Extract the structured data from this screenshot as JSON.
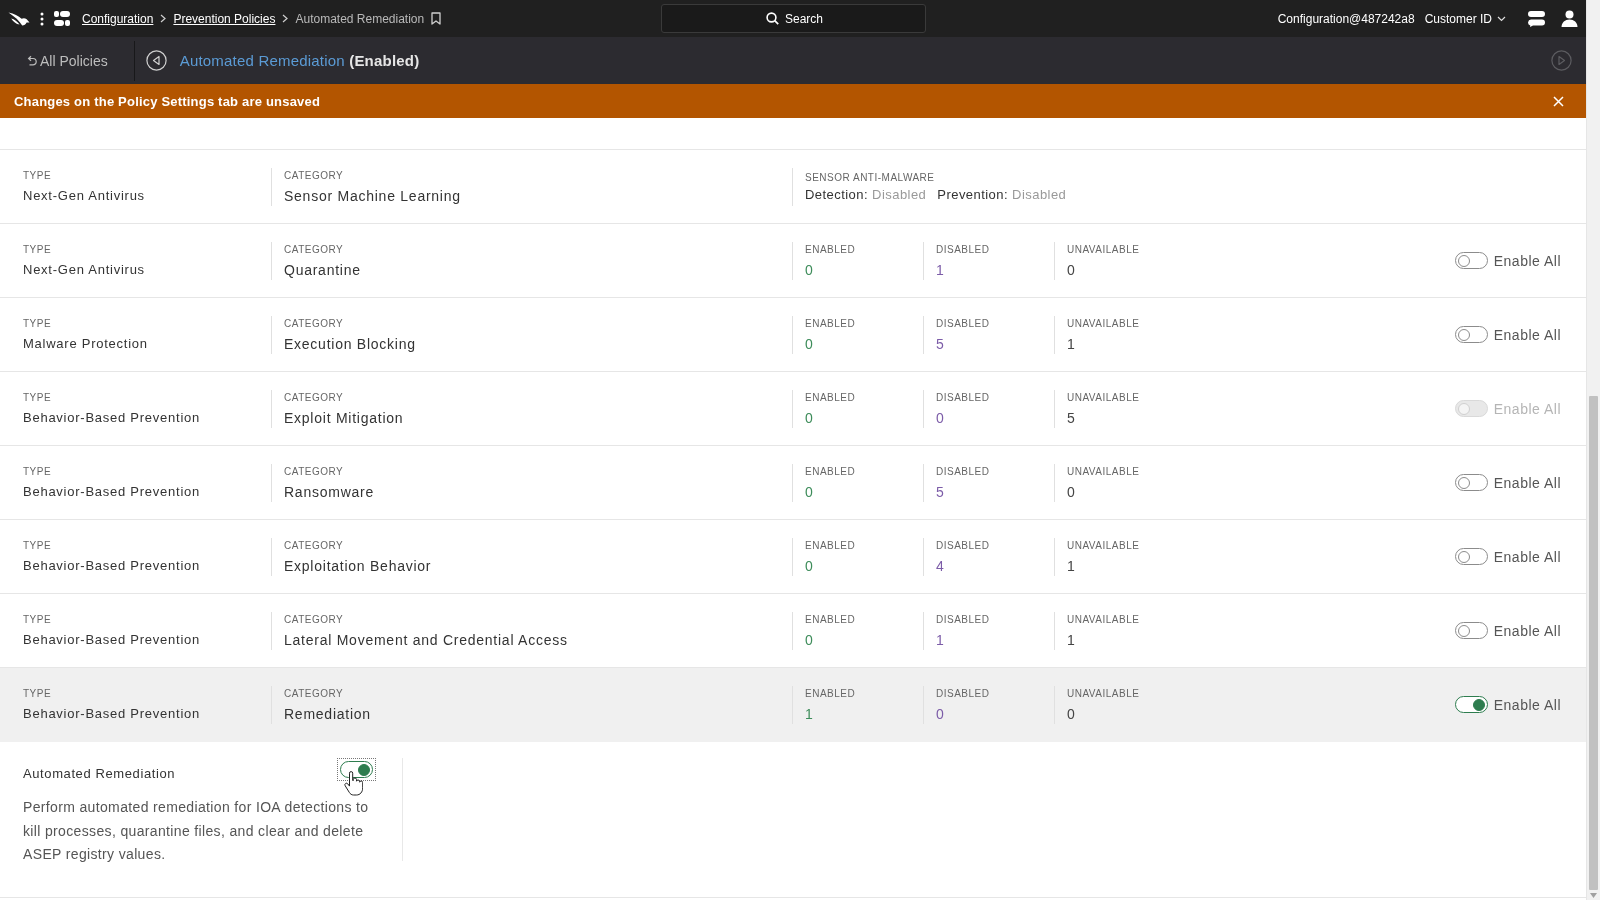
{
  "topbar": {
    "breadcrumbs": [
      {
        "label": "Configuration",
        "link": true
      },
      {
        "label": "Prevention Policies",
        "link": true
      },
      {
        "label": "Automated Remediation",
        "link": false
      }
    ],
    "search": {
      "placeholder": "Search"
    },
    "account": "Configuration@487242a8",
    "customer_menu": "Customer ID"
  },
  "policy_bar": {
    "back_label": "All Policies",
    "policy_name": "Automated Remediation",
    "policy_status": "(Enabled)"
  },
  "banner": {
    "message": "Changes on the Policy Settings tab are unsaved"
  },
  "rows": [
    {
      "kind": "sensor",
      "expanded": false,
      "type_label": "TYPE",
      "type": "Next-Gen Antivirus",
      "category_label": "CATEGORY",
      "category": "Sensor Machine Learning",
      "group_label": "SENSOR ANTI-MALWARE",
      "statuses": [
        {
          "label": "Detection:",
          "value": "Disabled"
        },
        {
          "label": "Prevention:",
          "value": "Disabled"
        }
      ]
    },
    {
      "kind": "counts",
      "expanded": false,
      "type_label": "TYPE",
      "type": "Next-Gen Antivirus",
      "category_label": "CATEGORY",
      "category": "Quarantine",
      "counts": [
        {
          "kind": "enabled",
          "label": "ENABLED",
          "value": "0"
        },
        {
          "kind": "disabled",
          "label": "DISABLED",
          "value": "1"
        },
        {
          "kind": "unavailable",
          "label": "UNAVAILABLE",
          "value": "0"
        }
      ],
      "toggle": {
        "label": "Enable All",
        "on": false,
        "disabled": false
      }
    },
    {
      "kind": "counts",
      "expanded": false,
      "type_label": "TYPE",
      "type": "Malware Protection",
      "category_label": "CATEGORY",
      "category": "Execution Blocking",
      "counts": [
        {
          "kind": "enabled",
          "label": "ENABLED",
          "value": "0"
        },
        {
          "kind": "disabled",
          "label": "DISABLED",
          "value": "5"
        },
        {
          "kind": "unavailable",
          "label": "UNAVAILABLE",
          "value": "1"
        }
      ],
      "toggle": {
        "label": "Enable All",
        "on": false,
        "disabled": false
      }
    },
    {
      "kind": "counts",
      "expanded": false,
      "type_label": "TYPE",
      "type": "Behavior-Based Prevention",
      "category_label": "CATEGORY",
      "category": "Exploit Mitigation",
      "counts": [
        {
          "kind": "enabled",
          "label": "ENABLED",
          "value": "0"
        },
        {
          "kind": "disabled",
          "label": "DISABLED",
          "value": "0"
        },
        {
          "kind": "unavailable",
          "label": "UNAVAILABLE",
          "value": "5"
        }
      ],
      "toggle": {
        "label": "Enable All",
        "on": false,
        "disabled": true
      }
    },
    {
      "kind": "counts",
      "expanded": false,
      "type_label": "TYPE",
      "type": "Behavior-Based Prevention",
      "category_label": "CATEGORY",
      "category": "Ransomware",
      "counts": [
        {
          "kind": "enabled",
          "label": "ENABLED",
          "value": "0"
        },
        {
          "kind": "disabled",
          "label": "DISABLED",
          "value": "5"
        },
        {
          "kind": "unavailable",
          "label": "UNAVAILABLE",
          "value": "0"
        }
      ],
      "toggle": {
        "label": "Enable All",
        "on": false,
        "disabled": false
      }
    },
    {
      "kind": "counts",
      "expanded": false,
      "type_label": "TYPE",
      "type": "Behavior-Based Prevention",
      "category_label": "CATEGORY",
      "category": "Exploitation Behavior",
      "counts": [
        {
          "kind": "enabled",
          "label": "ENABLED",
          "value": "0"
        },
        {
          "kind": "disabled",
          "label": "DISABLED",
          "value": "4"
        },
        {
          "kind": "unavailable",
          "label": "UNAVAILABLE",
          "value": "1"
        }
      ],
      "toggle": {
        "label": "Enable All",
        "on": false,
        "disabled": false
      }
    },
    {
      "kind": "counts",
      "expanded": false,
      "type_label": "TYPE",
      "type": "Behavior-Based Prevention",
      "category_label": "CATEGORY",
      "category": "Lateral Movement and Credential Access",
      "counts": [
        {
          "kind": "enabled",
          "label": "ENABLED",
          "value": "0"
        },
        {
          "kind": "disabled",
          "label": "DISABLED",
          "value": "1"
        },
        {
          "kind": "unavailable",
          "label": "UNAVAILABLE",
          "value": "1"
        }
      ],
      "toggle": {
        "label": "Enable All",
        "on": false,
        "disabled": false
      }
    },
    {
      "kind": "counts",
      "expanded": true,
      "type_label": "TYPE",
      "type": "Behavior-Based Prevention",
      "category_label": "CATEGORY",
      "category": "Remediation",
      "counts": [
        {
          "kind": "enabled",
          "label": "ENABLED",
          "value": "1"
        },
        {
          "kind": "disabled",
          "label": "DISABLED",
          "value": "0"
        },
        {
          "kind": "unavailable",
          "label": "UNAVAILABLE",
          "value": "0"
        }
      ],
      "toggle": {
        "label": "Enable All",
        "on": true,
        "disabled": false
      },
      "settings": [
        {
          "name": "Automated Remediation",
          "on": true,
          "focused": true,
          "description": "Perform automated remediation for IOA detections to kill processes, quarantine files, and clear and delete ASEP registry values."
        }
      ]
    }
  ]
}
